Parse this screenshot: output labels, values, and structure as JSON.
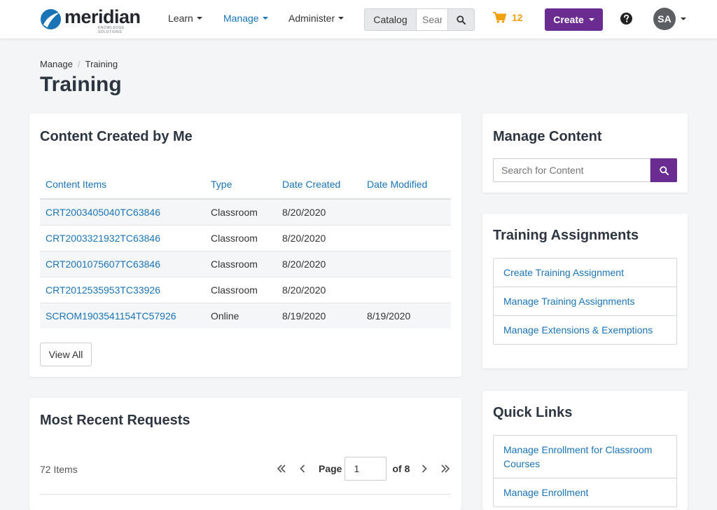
{
  "brand": {
    "name": "meridian",
    "tagline": "KNOWLEDGE SOLUTIONS",
    "color": "#1a73b5"
  },
  "nav": {
    "items": [
      {
        "label": "Learn",
        "active": false
      },
      {
        "label": "Manage",
        "active": true
      },
      {
        "label": "Administer",
        "active": false
      }
    ],
    "catalog_label": "Catalog",
    "search_placeholder": "Search",
    "cart_count": "12",
    "create_label": "Create",
    "user_initials": "SA"
  },
  "breadcrumb": [
    "Manage",
    "Training"
  ],
  "page_title": "Training",
  "content_created": {
    "title": "Content Created by Me",
    "columns": [
      "Content Items",
      "Type",
      "Date Created",
      "Date Modified"
    ],
    "rows": [
      {
        "item": "CRT2003405040TC63846",
        "type": "Classroom",
        "created": "8/20/2020",
        "modified": ""
      },
      {
        "item": "CRT2003321932TC63846",
        "type": "Classroom",
        "created": "8/20/2020",
        "modified": ""
      },
      {
        "item": "CRT2001075607TC63846",
        "type": "Classroom",
        "created": "8/20/2020",
        "modified": ""
      },
      {
        "item": "CRT2012535953TC33926",
        "type": "Classroom",
        "created": "8/20/2020",
        "modified": ""
      },
      {
        "item": "SCROM1903541154TC57926",
        "type": "Online",
        "created": "8/19/2020",
        "modified": "8/19/2020"
      }
    ],
    "view_all_label": "View All"
  },
  "recent_requests": {
    "title": "Most Recent Requests",
    "items_count": "72 Items",
    "page_label": "Page",
    "page_value": "1",
    "page_of": "of 8"
  },
  "manage_content": {
    "title": "Manage Content",
    "search_placeholder": "Search for Content"
  },
  "training_assignments": {
    "title": "Training Assignments",
    "links": [
      "Create Training Assignment",
      "Manage Training Assignments",
      "Manage Extensions & Exemptions"
    ]
  },
  "quick_links": {
    "title": "Quick Links",
    "links": [
      "Manage Enrollment for Classroom Courses",
      "Manage Enrollment"
    ]
  },
  "colors": {
    "accent": "#6b2c91",
    "link": "#1a73b5",
    "cart": "#f0a010"
  }
}
